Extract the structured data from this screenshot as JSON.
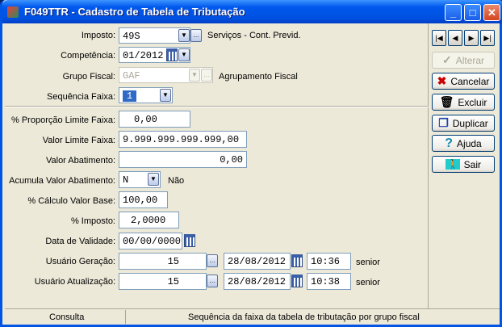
{
  "window": {
    "title": "F049TTR - Cadastro de Tabela de Tributação",
    "minimize": "_",
    "maximize": "□",
    "close": "✕"
  },
  "form": {
    "imposto": {
      "label": "Imposto:",
      "value": "49S",
      "desc": "Serviços - Cont. Previd."
    },
    "competencia": {
      "label": "Competência:",
      "value": "01/2012"
    },
    "grupo_fiscal": {
      "label": "Grupo Fiscal:",
      "value": "GAF",
      "desc": "Agrupamento Fiscal"
    },
    "sequencia_faixa": {
      "label": "Sequência Faixa:",
      "value": "1"
    },
    "proporcao": {
      "label": "% Proporção Limite Faixa:",
      "value": "0,00"
    },
    "valor_limite": {
      "label": "Valor Limite Faixa:",
      "value": "9.999.999.999.999,00"
    },
    "valor_abatimento": {
      "label": "Valor Abatimento:",
      "value": "0,00"
    },
    "acumula": {
      "label": "Acumula Valor Abatimento:",
      "value": "N",
      "desc": "Não"
    },
    "calculo_base": {
      "label": "% Cálculo Valor Base:",
      "value": "100,00"
    },
    "imposto_pct": {
      "label": "% Imposto:",
      "value": "2,0000"
    },
    "data_validade": {
      "label": "Data de Validade:",
      "value": "00/00/0000"
    },
    "usuario_geracao": {
      "label": "Usuário Geração:",
      "user": "15",
      "date": "28/08/2012",
      "time": "10:36",
      "name": "senior"
    },
    "usuario_atualizacao": {
      "label": "Usuário Atualização:",
      "user": "15",
      "date": "28/08/2012",
      "time": "10:38",
      "name": "senior"
    }
  },
  "nav": {
    "first": "|◀",
    "prev": "◀",
    "next": "▶",
    "last": "▶|"
  },
  "buttons": {
    "alterar": "Alterar",
    "cancelar": "Cancelar",
    "excluir": "Excluir",
    "duplicar": "Duplicar",
    "ajuda": "Ajuda",
    "sair": "Sair"
  },
  "status": {
    "mode": "Consulta",
    "hint": "Sequência da faixa da tabela de tributação por grupo fiscal"
  }
}
